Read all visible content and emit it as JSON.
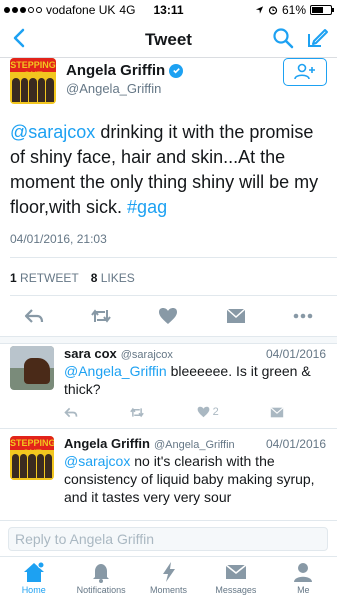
{
  "status_bar": {
    "carrier": "vodafone UK",
    "network": "4G",
    "time": "13:11",
    "battery": "61%",
    "battery_fraction": 0.61
  },
  "nav": {
    "title": "Tweet"
  },
  "main_tweet": {
    "name": "Angela Griffin",
    "handle": "@Angela_Griffin",
    "avatar_text": "STEPPING OUT",
    "mention": "@sarajcox",
    "text_before_hashtag": " drinking it with the promise of shiny face, hair and skin...At the moment the only thing shiny will be my floor,with sick. ",
    "hashtag": "#gag",
    "timestamp": "04/01/2016, 21:03",
    "retweets_count": "1",
    "retweets_label": "RETWEET",
    "likes_count": "8",
    "likes_label": "LIKES"
  },
  "replies": [
    {
      "name": "sara cox",
      "handle": "@sarajcox",
      "date": "04/01/2016",
      "mention": "@Angela_Griffin",
      "text": " bleeeeee. Is it green & thick?",
      "likes": "2"
    },
    {
      "name": "Angela Griffin",
      "handle": "@Angela_Griffin",
      "date": "04/01/2016",
      "avatar_text": "STEPPING OUT",
      "mention": "@sarajcox",
      "text": " no it's clearish with the consistency of liquid baby making syrup, and it tastes very very sour"
    }
  ],
  "reply_bar": {
    "placeholder": "Reply to Angela Griffin"
  },
  "tabs": [
    {
      "label": "Home",
      "icon": "home-icon",
      "active": true
    },
    {
      "label": "Notifications",
      "icon": "bell-icon",
      "active": false
    },
    {
      "label": "Moments",
      "icon": "lightning-icon",
      "active": false
    },
    {
      "label": "Messages",
      "icon": "envelope-icon",
      "active": false
    },
    {
      "label": "Me",
      "icon": "person-icon",
      "active": false
    }
  ],
  "colors": {
    "accent": "#1da1f2",
    "text": "#14171a",
    "muted": "#657786",
    "icon_gray": "#aab8c2",
    "divider": "#e1e8ed"
  }
}
